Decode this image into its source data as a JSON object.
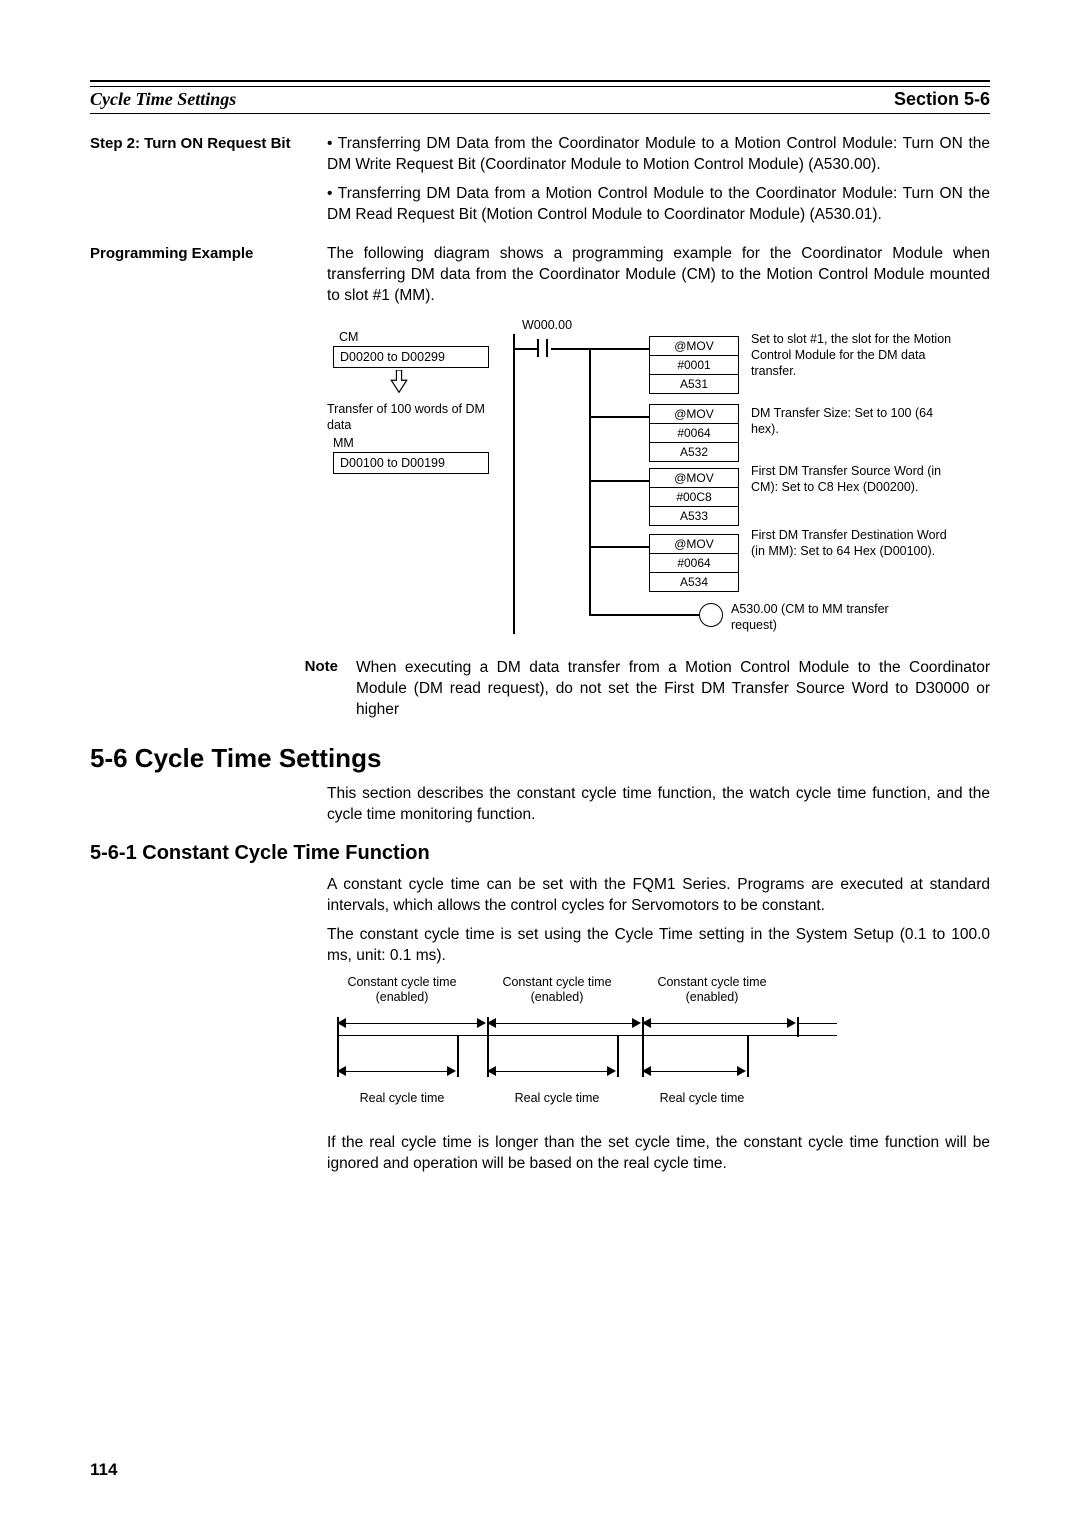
{
  "header": {
    "left": "Cycle Time Settings",
    "right": "Section 5-6"
  },
  "step2": {
    "label": "Step 2: Turn ON Request Bit",
    "bullet1": "Transferring DM Data from the Coordinator Module to a Motion Control Module: Turn ON the DM Write Request Bit (Coordinator Module to Motion Control Module) (A530.00).",
    "bullet2": "Transferring DM Data from a Motion Control Module to the Coordinator Module: Turn ON the DM Read Request Bit (Motion Control Module to Coordinator Module) (A530.01)."
  },
  "progExample": {
    "label": "Programming Example",
    "intro": "The following diagram shows a programming example for the Coordinator Module when transferring DM data from the Coordinator Module (CM) to the Motion Control Module mounted to slot #1 (MM)."
  },
  "diagram1": {
    "cm_label": "CM",
    "cm_range": "D00200 to D00299",
    "transfer_text": "Transfer of 100 words of DM data",
    "mm_label": "MM",
    "mm_range": "D00100 to D00199",
    "contact_label": "W000.00",
    "mov": [
      {
        "op": "@MOV",
        "v1": "#0001",
        "v2": "A531",
        "note": "Set to slot #1, the slot for the Motion Control Module for the DM data transfer."
      },
      {
        "op": "@MOV",
        "v1": "#0064",
        "v2": "A532",
        "note": "DM Transfer Size: Set to 100 (64 hex)."
      },
      {
        "op": "@MOV",
        "v1": "#00C8",
        "v2": "A533",
        "note": "First DM Transfer Source Word (in CM): Set to C8 Hex (D00200)."
      },
      {
        "op": "@MOV",
        "v1": "#0064",
        "v2": "A534",
        "note": "First DM Transfer Destination Word (in MM): Set to 64 Hex (D00100)."
      }
    ],
    "coil_note": "A530.00 (CM to MM transfer request)"
  },
  "note": {
    "label": "Note",
    "body": "When executing a DM data transfer from a Motion Control Module to the Coordinator Module (DM read request), do not set the First DM Transfer Source Word to D30000 or higher"
  },
  "section56": {
    "title": "5-6    Cycle Time Settings",
    "intro": "This section describes the constant cycle time function, the watch cycle time function, and the cycle time monitoring function."
  },
  "section561": {
    "title": "5-6-1    Constant Cycle Time Function",
    "p1": "A constant cycle time can be set with the FQM1 Series. Programs are executed at standard intervals, which allows the control cycles for Servomotors to be constant.",
    "p2": "The constant cycle time is set using the Cycle Time setting in the System Setup (0.1 to 100.0 ms, unit: 0.1 ms).",
    "p3": "If the real cycle time is longer than the set cycle time, the constant cycle time function will be ignored and operation will be based on the real cycle time."
  },
  "diagram2": {
    "top_label": "Constant cycle time (enabled)",
    "bot_label": "Real cycle time"
  },
  "page_number": "114"
}
